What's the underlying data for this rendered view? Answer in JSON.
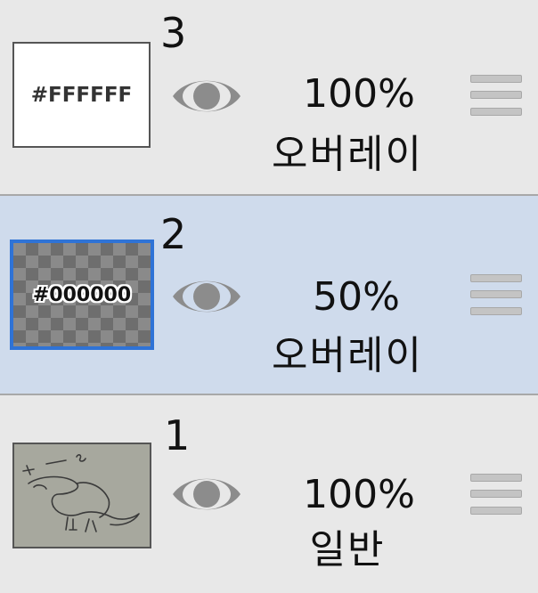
{
  "layers": [
    {
      "number": "3",
      "thumbnail": {
        "label": "#FFFFFF",
        "kind": "solid-white"
      },
      "opacity": "100%",
      "blend_mode": "오버레이",
      "visible": true,
      "selected": false
    },
    {
      "number": "2",
      "thumbnail": {
        "label": "#000000",
        "kind": "transparent-checker"
      },
      "opacity": "50%",
      "blend_mode": "오버레이",
      "visible": true,
      "selected": true
    },
    {
      "number": "1",
      "thumbnail": {
        "label": "",
        "kind": "sketch-image"
      },
      "opacity": "100%",
      "blend_mode": "일반",
      "visible": true,
      "selected": false
    }
  ],
  "colors": {
    "panel_bg": "#e8e8e8",
    "selected_bg": "#cfdbec",
    "selected_border": "#2f73d6",
    "eye_icon": "#8c8c8c"
  }
}
